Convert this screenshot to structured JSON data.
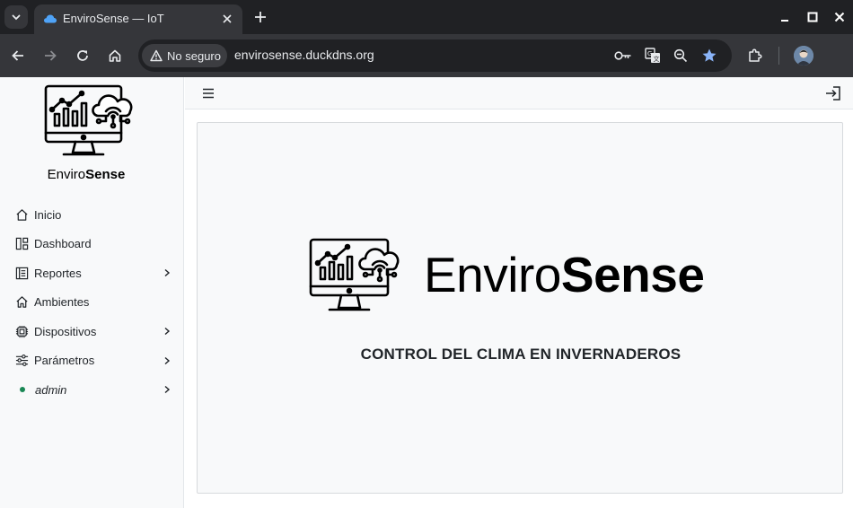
{
  "browser": {
    "tab_title": "EnviroSense — IoT",
    "security_label": "No seguro",
    "url": "envirosense.duckdns.org"
  },
  "sidebar": {
    "logo_text_light": "Enviro",
    "logo_text_bold": "Sense",
    "items": [
      {
        "label": "Inicio",
        "icon": "house-icon",
        "has_chevron": false
      },
      {
        "label": "Dashboard",
        "icon": "dashboard-icon",
        "has_chevron": false
      },
      {
        "label": "Reportes",
        "icon": "report-icon",
        "has_chevron": true
      },
      {
        "label": "Ambientes",
        "icon": "house-icon",
        "has_chevron": false
      },
      {
        "label": "Dispositivos",
        "icon": "cpu-icon",
        "has_chevron": true
      },
      {
        "label": "Parámetros",
        "icon": "sliders-icon",
        "has_chevron": true
      },
      {
        "label": "admin",
        "icon": "status-dot",
        "has_chevron": true
      }
    ]
  },
  "main": {
    "brand_light": "Enviro",
    "brand_bold": "Sense",
    "subtitle": "CONTROL DEL CLIMA EN INVERNADEROS"
  },
  "colors": {
    "chrome_dark": "#202124",
    "chrome_tab": "#35363a",
    "sidebar_bg": "#f8f9fa",
    "status_green": "#198754",
    "bookmark_star": "#8ab4f8"
  }
}
